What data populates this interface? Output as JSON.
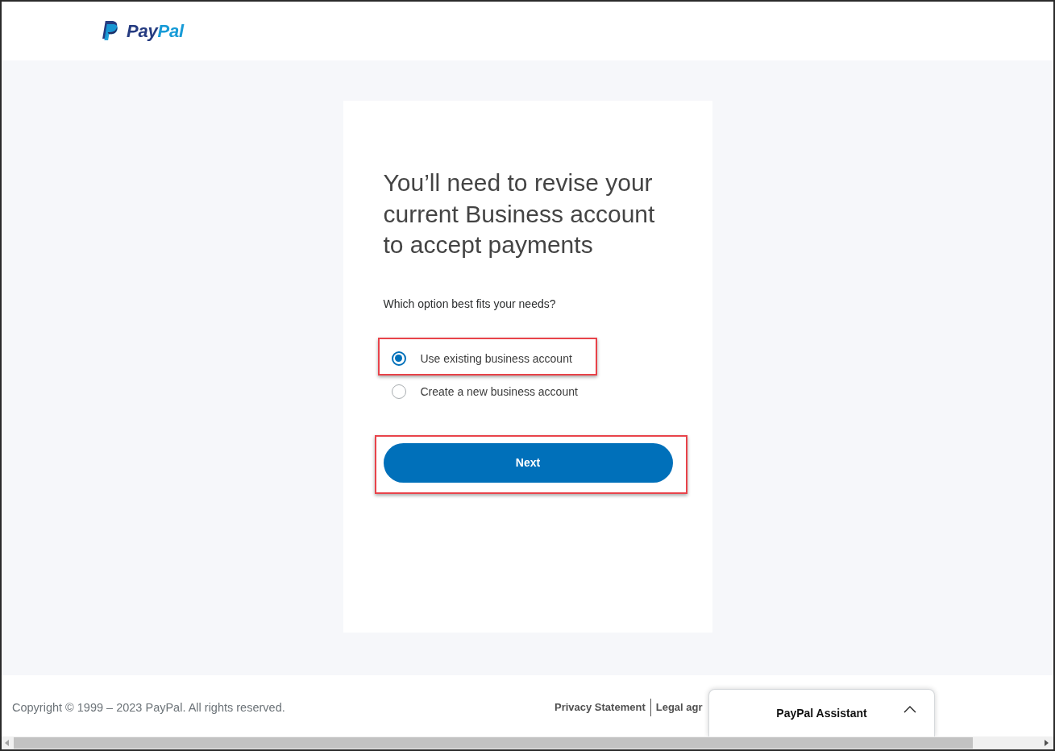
{
  "header": {
    "logo": {
      "primary": "Pay",
      "secondary": "Pal"
    }
  },
  "card": {
    "heading": "You’ll need to revise your current Business account to accept payments",
    "question": "Which option best fits your needs?",
    "options": [
      {
        "label": "Use existing business account",
        "selected": true,
        "highlighted": true
      },
      {
        "label": "Create a new business account",
        "selected": false,
        "highlighted": false
      }
    ],
    "next_button": {
      "label": "Next",
      "highlighted": true
    }
  },
  "footer": {
    "copyright": "Copyright © 1999 – 2023 PayPal. All rights reserved.",
    "links": [
      "Privacy Statement",
      "Legal agr"
    ]
  },
  "assistant": {
    "title": "PayPal Assistant",
    "expanded": false
  }
}
